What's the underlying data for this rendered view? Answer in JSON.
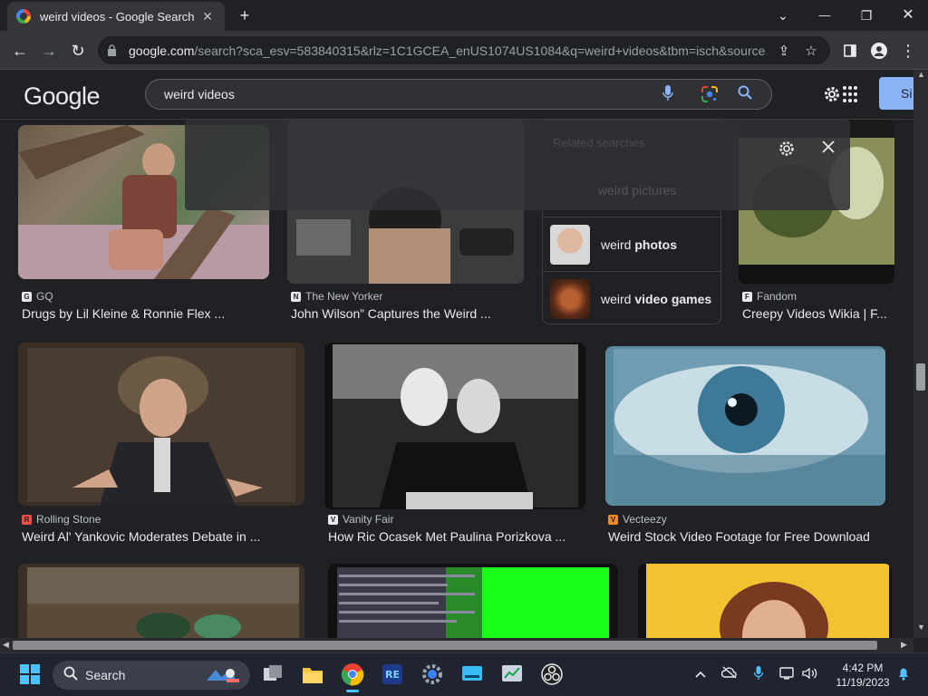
{
  "browser": {
    "tab_title": "weird videos - Google Search",
    "tab_close": "✕",
    "new_tab": "+",
    "window_controls": {
      "dropdown": "⌄",
      "minimize": "—",
      "restore": "❐",
      "close": "✕"
    },
    "nav": {
      "back": "←",
      "forward": "→",
      "reload": "↻"
    },
    "url_domain": "google.com",
    "url_path": "/search?sca_esv=583840315&rlz=1C1GCEA_enUS1074US1084&q=weird+videos&tbm=isch&source...",
    "omni_icons": [
      "share-icon",
      "star-icon",
      "side-panel-icon",
      "profile-icon",
      "menu-icon"
    ]
  },
  "google": {
    "logo": "Google",
    "query": "weird videos",
    "signin_label": "Si"
  },
  "overlay": {
    "heading": "Related searches",
    "sub": "weird pictures"
  },
  "related": [
    {
      "prefix": "weird ",
      "bold": "photos",
      "thumb_color": "#c9a28a"
    },
    {
      "prefix": "weird ",
      "bold": "video games",
      "thumb_color": "#8a4a2a"
    }
  ],
  "results_row1": [
    {
      "source": "GQ",
      "title": "Drugs by Lil Kleine & Ronnie Flex ...",
      "fav_color": "#e8eaed",
      "fav_text": "G"
    },
    {
      "source": "The New Yorker",
      "title": "John Wilson” Captures the Weird ...",
      "fav_color": "#e8eaed",
      "fav_text": "N"
    },
    {
      "source": "Fandom",
      "title": "Creepy Videos Wikia | F...",
      "fav_color": "#e8eaed",
      "fav_text": "F"
    }
  ],
  "results_row2": [
    {
      "source": "Rolling Stone",
      "title": "Weird Al' Yankovic Moderates Debate in ...",
      "fav_color": "#e8504a",
      "fav_text": "R"
    },
    {
      "source": "Vanity Fair",
      "title": "How Ric Ocasek Met Paulina Porizkova ...",
      "fav_color": "#e8eaed",
      "fav_text": "V"
    },
    {
      "source": "Vecteezy",
      "title": "Weird Stock Video Footage for Free Download",
      "fav_color": "#f08a24",
      "fav_text": "V"
    }
  ],
  "taskbar": {
    "search_label": "Search",
    "time": "4:42 PM",
    "date": "11/19/2023"
  }
}
